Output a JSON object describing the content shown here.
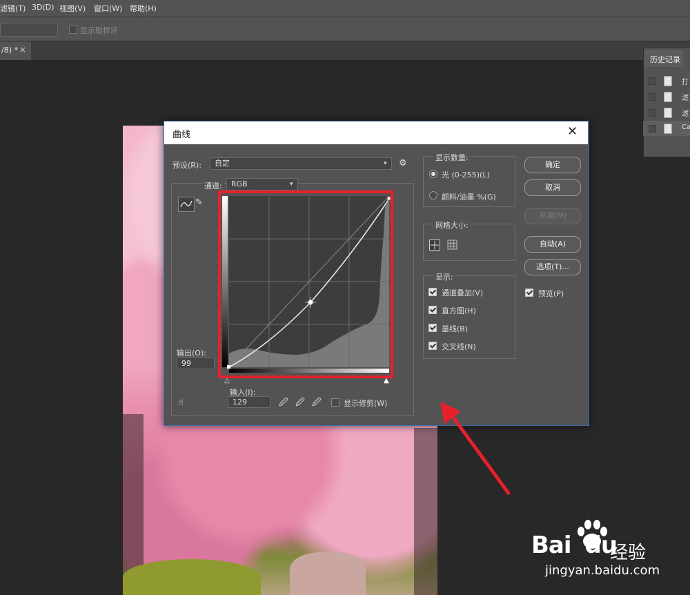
{
  "menu": [
    "滤镜(T)",
    "3D(D)",
    "视图(V)",
    "窗口(W)",
    "帮助(H)"
  ],
  "options_bar": {
    "sample_ring_label": "显示取样环"
  },
  "document_tab": {
    "label": "/8) *",
    "close": "×"
  },
  "history_panel": {
    "title": "历史记录",
    "items": [
      "打",
      "滤",
      "滤",
      "Ca"
    ]
  },
  "dialog": {
    "title": "曲线",
    "close": "✕",
    "preset_label": "预设(R):",
    "preset_value": "自定",
    "channel_label": "通道:",
    "channel_value": "RGB",
    "output_label": "输出(O):",
    "output_value": "99",
    "input_label": "输入(I):",
    "input_value": "129",
    "show_clipping_label": "显示修剪(W)",
    "display_amount": {
      "title": "显示数量:",
      "options": [
        "光 (0-255)(L)",
        "颜料/油墨 %(G)"
      ],
      "selected": 0
    },
    "grid_size": {
      "title": "网格大小:"
    },
    "show": {
      "title": "显示:",
      "options": [
        "通道叠加(V)",
        "直方图(H)",
        "基线(B)",
        "交叉线(N)"
      ]
    },
    "buttons": {
      "ok": "确定",
      "cancel": "取消",
      "smooth": "平滑(M)",
      "auto": "自动(A)",
      "options": "选项(T)..."
    },
    "preview_label": "预览(P)",
    "curve_point": {
      "input": 129,
      "output": 99
    }
  },
  "watermark": {
    "brand": "Bai",
    "brand2": "du",
    "cn": "经验",
    "url": "jingyan.baidu.com"
  },
  "colors": {
    "highlight": "#e8202a",
    "dialog_bg": "#535353",
    "dialog_border": "#3a6fb0"
  }
}
